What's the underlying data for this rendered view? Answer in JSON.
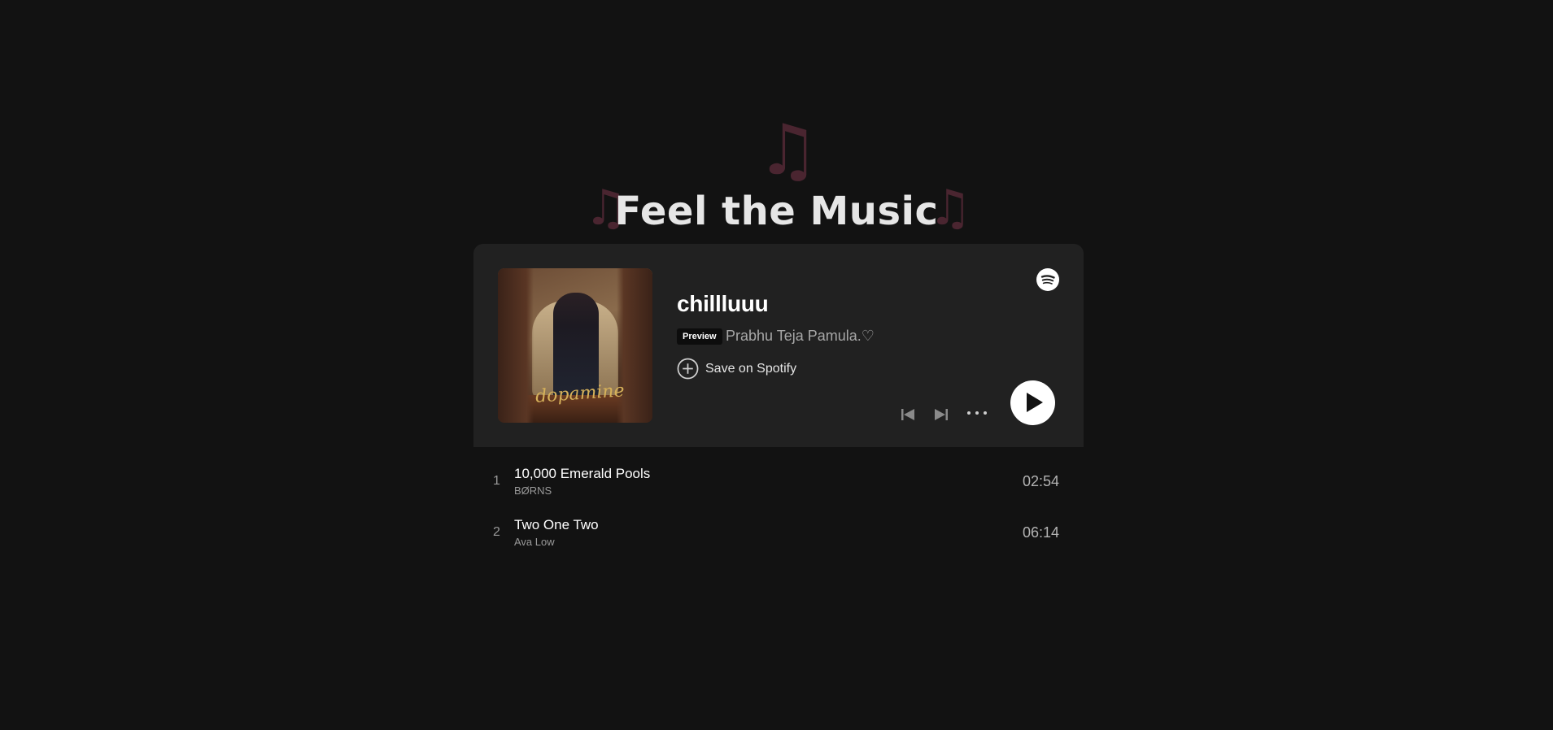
{
  "header": {
    "title": "Feel the Music",
    "note_glyph": "♫",
    "note_color": "#4a2530"
  },
  "playlist": {
    "title": "chillluuu",
    "badge": "Preview",
    "owner": "Prabhu Teja Pamula.♡",
    "save_label": "Save on Spotify",
    "cover_script": "dopamine"
  },
  "controls": {
    "icons": [
      "previous-icon",
      "next-icon",
      "more-icon",
      "play-icon",
      "spotify-icon"
    ],
    "accent": "#ffffff"
  },
  "tracks": [
    {
      "number": "1",
      "title": "10,000 Emerald Pools",
      "artist": "BØRNS",
      "duration": "02:54"
    },
    {
      "number": "2",
      "title": "Two One Two",
      "artist": "Ava Low",
      "duration": "06:14"
    }
  ],
  "colors": {
    "background": "#121212",
    "card": "#212121"
  }
}
